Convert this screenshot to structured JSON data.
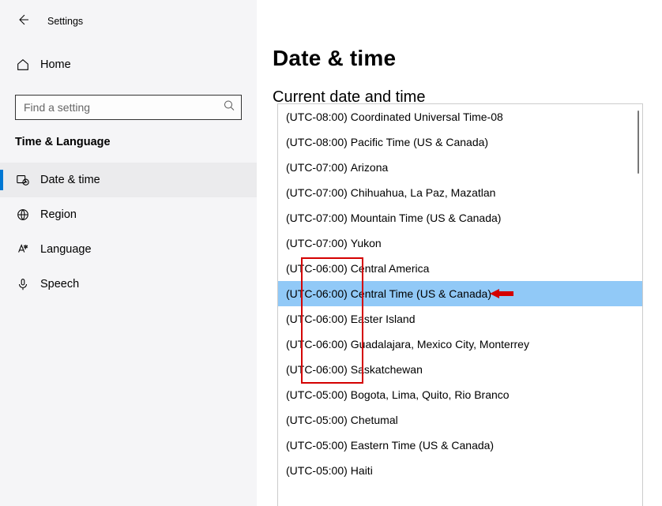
{
  "sidebar": {
    "back_label": "Back",
    "title": "Settings",
    "home_label": "Home",
    "search_placeholder": "Find a setting",
    "section_label": "Time & Language",
    "items": [
      {
        "label": "Date & time",
        "active": true
      },
      {
        "label": "Region",
        "active": false
      },
      {
        "label": "Language",
        "active": false
      },
      {
        "label": "Speech",
        "active": false
      }
    ]
  },
  "main": {
    "title": "Date & time",
    "subtitle": "Current date and time"
  },
  "timezones": [
    {
      "offset": "(UTC-08:00)",
      "name": "Coordinated Universal Time-08",
      "selected": false
    },
    {
      "offset": "(UTC-08:00)",
      "name": "Pacific Time (US & Canada)",
      "selected": false
    },
    {
      "offset": "(UTC-07:00)",
      "name": "Arizona",
      "selected": false
    },
    {
      "offset": "(UTC-07:00)",
      "name": "Chihuahua, La Paz, Mazatlan",
      "selected": false
    },
    {
      "offset": "(UTC-07:00)",
      "name": "Mountain Time (US & Canada)",
      "selected": false
    },
    {
      "offset": "(UTC-07:00)",
      "name": "Yukon",
      "selected": false
    },
    {
      "offset": "(UTC-06:00)",
      "name": "Central America",
      "selected": false
    },
    {
      "offset": "(UTC-06:00)",
      "name": "Central Time (US & Canada)",
      "selected": true
    },
    {
      "offset": "(UTC-06:00)",
      "name": "Easter Island",
      "selected": false
    },
    {
      "offset": "(UTC-06:00)",
      "name": "Guadalajara, Mexico City, Monterrey",
      "selected": false
    },
    {
      "offset": "(UTC-06:00)",
      "name": "Saskatchewan",
      "selected": false
    },
    {
      "offset": "(UTC-05:00)",
      "name": "Bogota, Lima, Quito, Rio Branco",
      "selected": false
    },
    {
      "offset": "(UTC-05:00)",
      "name": "Chetumal",
      "selected": false
    },
    {
      "offset": "(UTC-05:00)",
      "name": "Eastern Time (US & Canada)",
      "selected": false
    },
    {
      "offset": "(UTC-05:00)",
      "name": "Haiti",
      "selected": false
    }
  ],
  "annotation": {
    "highlight_offset_group": "(UTC-06:00)",
    "arrow_target": "Central Time (US & Canada)"
  }
}
